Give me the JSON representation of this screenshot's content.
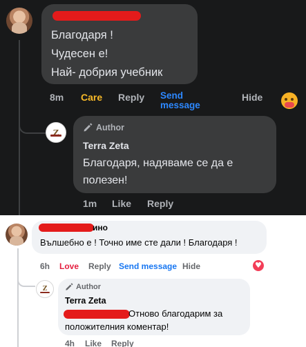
{
  "dark_thread": {
    "comment": {
      "lines": [
        "Благодаря !",
        "Чудесен е!",
        "Най- добрия учебник"
      ],
      "time": "8m",
      "reaction": "Care",
      "reply": "Reply",
      "send_message": "Send message",
      "hide": "Hide",
      "reaction_color": "#f7b928"
    },
    "reply": {
      "author_badge": "Author",
      "name": "Terra Zeta",
      "text": "Благодаря, надяваме се да е полезен!",
      "time": "1m",
      "like": "Like",
      "reply": "Reply"
    }
  },
  "light_thread": {
    "comment": {
      "name_tail": "ино",
      "text": "Вълшебно е ! Точно име сте дали ! Благодаря !",
      "time": "6h",
      "reaction": "Love",
      "reply": "Reply",
      "send_message": "Send message",
      "hide": "Hide",
      "reaction_color": "#e41e3f"
    },
    "reply": {
      "author_badge": "Author",
      "name": "Terra Zeta",
      "text": "Отново благодарим за положителния коментар!",
      "time": "4h",
      "like": "Like",
      "reply": "Reply"
    }
  }
}
